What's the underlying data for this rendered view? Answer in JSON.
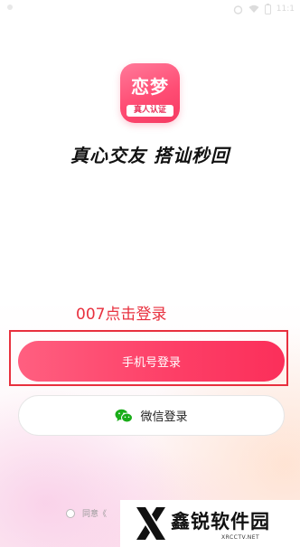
{
  "status_bar": {
    "time": "11:1"
  },
  "logo": {
    "title": "恋梦",
    "subtitle": "真人认证"
  },
  "slogan": "真心交友 搭讪秒回",
  "annotation": "007点击登录",
  "buttons": {
    "phone_login": "手机号登录",
    "wechat_login": "微信登录"
  },
  "agreement": {
    "text": "同意《"
  },
  "watermark": {
    "name": "鑫锐软件园",
    "site": "XRCCTV.NET"
  },
  "colors": {
    "accent": "#fd3e66",
    "annotation": "#e8303e",
    "wechat": "#1aad19"
  }
}
